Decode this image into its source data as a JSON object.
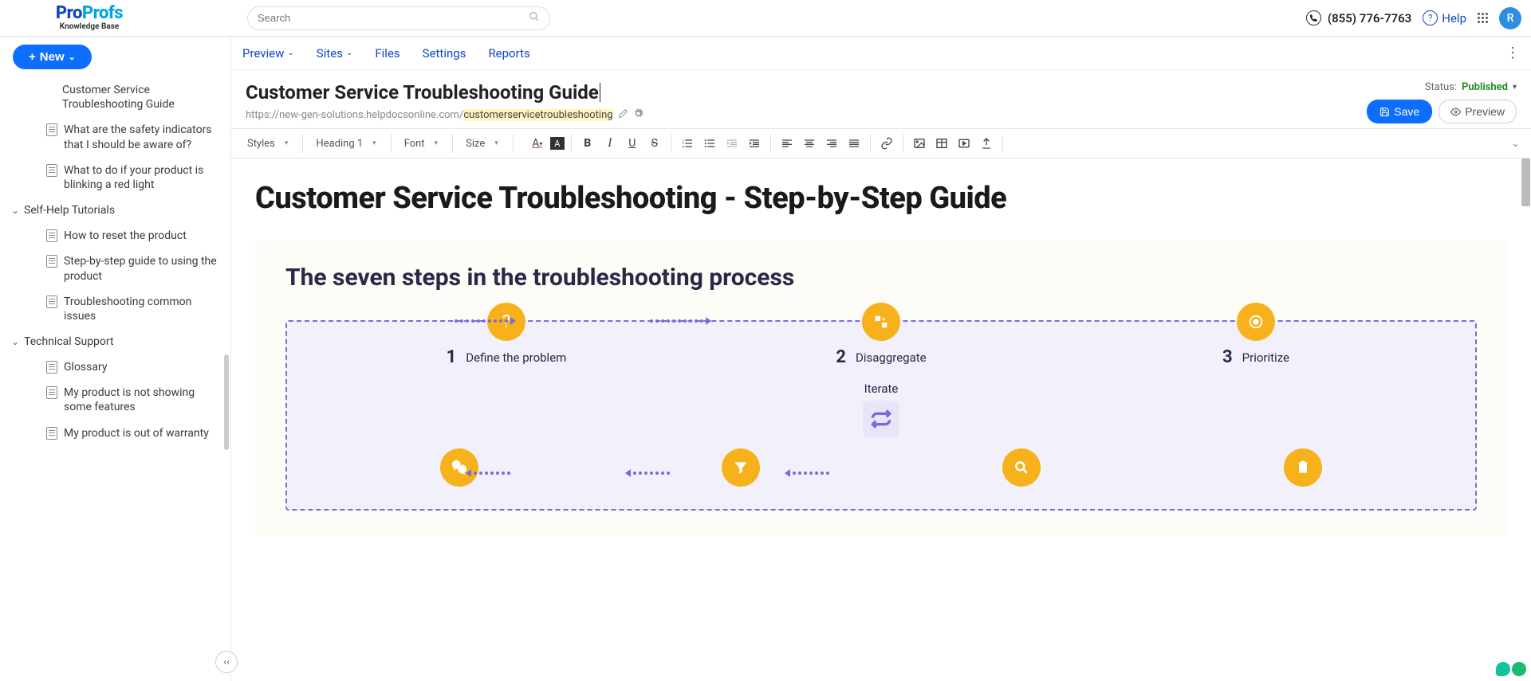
{
  "logo": {
    "part1": "Pro",
    "part2": "Profs",
    "sub": "Knowledge Base"
  },
  "search": {
    "placeholder": "Search"
  },
  "topright": {
    "phone": "(855) 776-7763",
    "help": "Help",
    "avatar": "R"
  },
  "new_btn": "New",
  "tree": {
    "items": [
      "Customer Service Troubleshooting Guide",
      "What are the safety indicators that I should be aware of?",
      "What to do if your product is blinking a red light"
    ],
    "folder1": "Self-Help Tutorials",
    "f1items": [
      "How to reset the product",
      "Step-by-step guide to using the product",
      "Troubleshooting common issues"
    ],
    "folder2": "Technical Support",
    "f2items": [
      "Glossary",
      "My product is not showing some features",
      "My product is out of warranty"
    ]
  },
  "menubar": {
    "preview": "Preview",
    "sites": "Sites",
    "files": "Files",
    "settings": "Settings",
    "reports": "Reports"
  },
  "page": {
    "title": "Customer Service Troubleshooting Guide",
    "url_prefix": "https://new-gen-solutions.helpdocsonline.com/",
    "url_slug": "customerservicetroubleshooting"
  },
  "status": {
    "label": "Status:",
    "value": "Published"
  },
  "buttons": {
    "save": "Save",
    "preview": "Preview"
  },
  "toolbar": {
    "styles": "Styles",
    "heading": "Heading 1",
    "font": "Font",
    "size": "Size"
  },
  "doc": {
    "h1": "Customer Service Troubleshooting - Step-by-Step Guide",
    "diag_title": "The seven steps in the troubleshooting process",
    "steps_top": [
      {
        "num": "1",
        "txt": "Define the problem"
      },
      {
        "num": "2",
        "txt": "Disaggregate"
      },
      {
        "num": "3",
        "txt": "Prioritize"
      }
    ],
    "iterate": "Iterate"
  }
}
